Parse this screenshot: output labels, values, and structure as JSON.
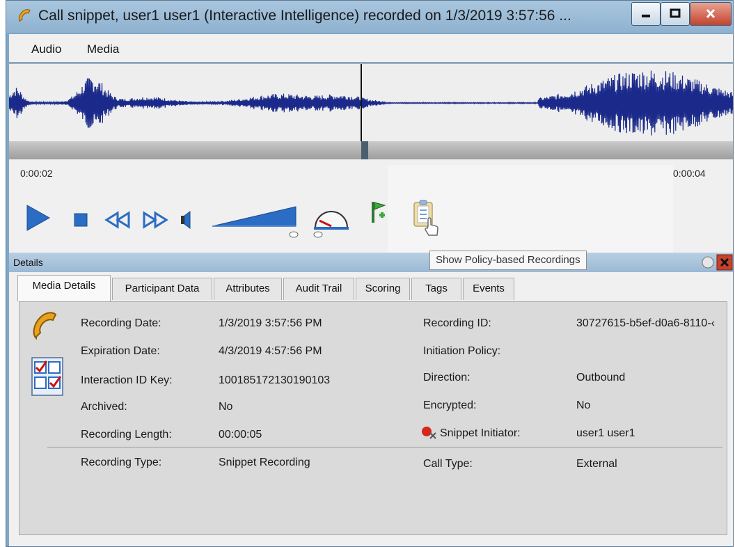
{
  "window": {
    "title": "Call snippet, user1 user1 (Interactive Intelligence) recorded on 1/3/2019 3:57:56 ..."
  },
  "menu": [
    "Audio",
    "Media"
  ],
  "player": {
    "time_start": "0:00:02",
    "time_end": "0:00:04",
    "position_fraction": 0.49
  },
  "tooltip": "Show Policy-based Recordings",
  "details": {
    "title": "Details",
    "tabs": [
      "Media Details",
      "Participant Data",
      "Attributes",
      "Audit Trail",
      "Scoring",
      "Tags",
      "Events"
    ],
    "active_tab": "Media Details",
    "left_fields": [
      {
        "label": "Recording Date:",
        "value": "1/3/2019 3:57:56 PM"
      },
      {
        "label": "Expiration Date:",
        "value": "4/3/2019 4:57:56 PM"
      },
      {
        "label": "Interaction ID Key:",
        "value": "100185172130190103"
      },
      {
        "label": "Archived:",
        "value": "No"
      },
      {
        "label": "Recording Length:",
        "value": "00:00:05"
      },
      {
        "label": "Recording Type:",
        "value": "Snippet Recording"
      }
    ],
    "right_fields": [
      {
        "label": "Recording ID:",
        "value": "30727615-b5ef-d0a6-8110-‹"
      },
      {
        "label": "Initiation Policy:",
        "value": ""
      },
      {
        "label": "Direction:",
        "value": "Outbound"
      },
      {
        "label": "Encrypted:",
        "value": "No"
      },
      {
        "label": "Snippet Initiator:",
        "value": "user1 user1"
      },
      {
        "label": "Call Type:",
        "value": "External"
      }
    ]
  },
  "colors": {
    "waveform": "#1b2a8a",
    "accent_blue": "#2b6cc4",
    "close_red": "#c4432c"
  }
}
